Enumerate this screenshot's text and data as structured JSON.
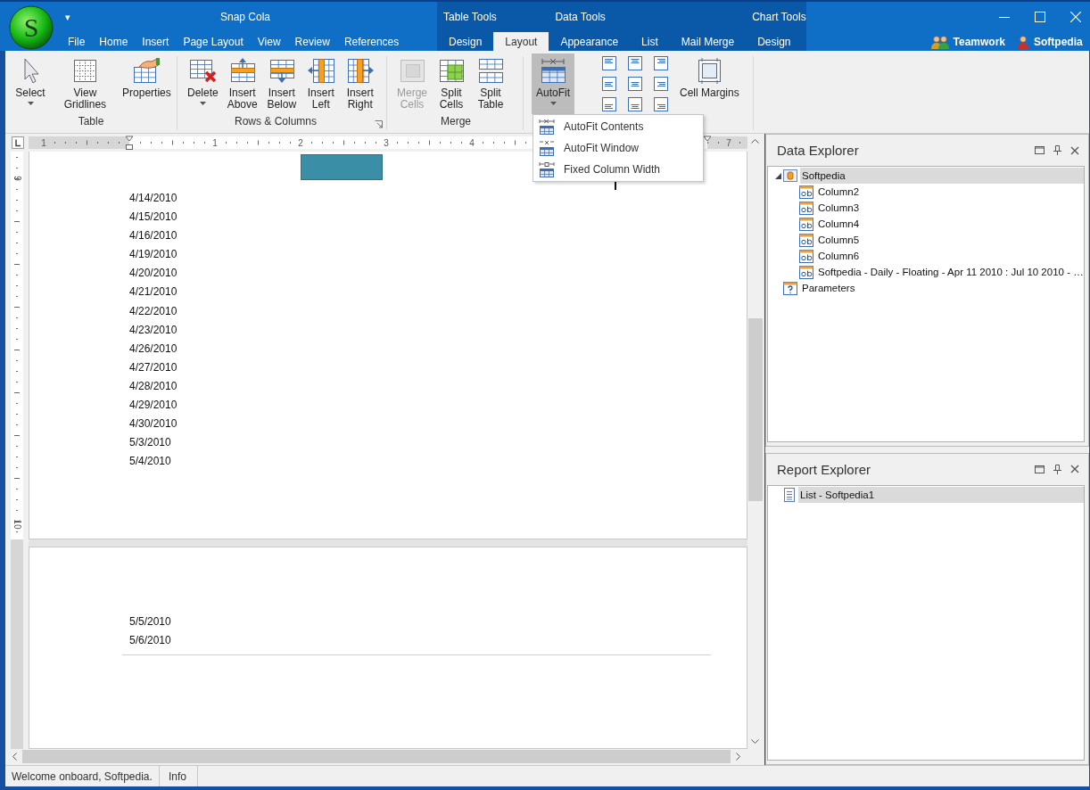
{
  "window": {
    "title": "Snap Cola",
    "logo_letter": "S",
    "quick_access": "▾"
  },
  "tabs": [
    {
      "label": "File",
      "selected": false
    },
    {
      "label": "Home",
      "selected": false
    },
    {
      "label": "Insert",
      "selected": false
    },
    {
      "label": "Page Layout",
      "selected": false
    },
    {
      "label": "View",
      "selected": false
    },
    {
      "label": "Review",
      "selected": false
    },
    {
      "label": "References",
      "selected": false
    }
  ],
  "context_groups": [
    {
      "label": "Table Tools",
      "tabs": [
        {
          "label": "Design",
          "selected": false
        },
        {
          "label": "Layout",
          "selected": true
        }
      ]
    },
    {
      "label": "Data Tools",
      "tabs": [
        {
          "label": "Appearance",
          "selected": false
        },
        {
          "label": "List",
          "selected": false
        },
        {
          "label": "Mail Merge",
          "selected": false
        }
      ]
    },
    {
      "label": "Chart Tools",
      "tabs": [
        {
          "label": "Design",
          "selected": false
        }
      ]
    }
  ],
  "users": [
    {
      "label": "Teamwork",
      "kind": "group"
    },
    {
      "label": "Softpedia",
      "kind": "person"
    }
  ],
  "ribbon": {
    "groups": [
      {
        "label": "Table",
        "launcher": false,
        "buttons": [
          {
            "label": "Select",
            "kind": "pointer",
            "menu": true,
            "disabled": false,
            "pressed": false
          },
          {
            "label": "View Gridlines",
            "kind": "gridlines",
            "menu": false,
            "disabled": false,
            "pressed": false
          },
          {
            "label": "Properties",
            "kind": "properties",
            "menu": false,
            "disabled": false,
            "pressed": false
          }
        ]
      },
      {
        "label": "Rows & Columns",
        "launcher": true,
        "buttons": [
          {
            "label": "Delete",
            "kind": "delete",
            "menu": true,
            "disabled": false,
            "pressed": false
          },
          {
            "label": "Insert\nAbove",
            "kind": "insert_above",
            "menu": false,
            "disabled": false,
            "pressed": false
          },
          {
            "label": "Insert\nBelow",
            "kind": "insert_below",
            "menu": false,
            "disabled": false,
            "pressed": false
          },
          {
            "label": "Insert\nLeft",
            "kind": "insert_left",
            "menu": false,
            "disabled": false,
            "pressed": false
          },
          {
            "label": "Insert\nRight",
            "kind": "insert_right",
            "menu": false,
            "disabled": false,
            "pressed": false
          }
        ]
      },
      {
        "label": "Merge",
        "launcher": false,
        "buttons": [
          {
            "label": "Merge\nCells",
            "kind": "merge",
            "menu": false,
            "disabled": true,
            "pressed": false
          },
          {
            "label": "Split\nCells",
            "kind": "split_cells",
            "menu": false,
            "disabled": false,
            "pressed": false
          },
          {
            "label": "Split\nTable",
            "kind": "split_table",
            "menu": false,
            "disabled": false,
            "pressed": false
          }
        ]
      },
      {
        "launcher": false,
        "buttons": [
          {
            "label": "AutoFit",
            "kind": "autofit",
            "menu": true,
            "disabled": false,
            "pressed": true
          }
        ]
      },
      {
        "kind": "alignment",
        "launcher": false,
        "buttons": [
          {
            "label": "Cell Margins",
            "kind": "margins",
            "menu": false,
            "disabled": false,
            "pressed": false
          }
        ]
      }
    ]
  },
  "autofit_menu": {
    "items": [
      {
        "label": "AutoFit Contents",
        "kind": "contents"
      },
      {
        "label": "AutoFit Window",
        "kind": "window"
      },
      {
        "label": "Fixed Column Width",
        "kind": "fixed"
      }
    ]
  },
  "ruler": {
    "labels": [
      "1",
      "1",
      "2",
      "3",
      "4",
      "7"
    ]
  },
  "vertical_ruler": {
    "labels": [
      "9",
      "10"
    ]
  },
  "pages": [
    {
      "header_block": true,
      "dates": [
        "4/14/2010",
        "4/15/2010",
        "4/16/2010",
        "4/19/2010",
        "4/20/2010",
        "4/21/2010",
        "4/22/2010",
        "4/23/2010",
        "4/26/2010",
        "4/27/2010",
        "4/28/2010",
        "4/29/2010",
        "4/30/2010",
        "5/3/2010",
        "5/4/2010"
      ]
    },
    {
      "header_block": false,
      "dates": [
        "5/5/2010",
        "5/6/2010"
      ]
    }
  ],
  "data_explorer": {
    "title": "Data Explorer",
    "tree": [
      {
        "label": "Softpedia",
        "kind": "datasource",
        "selected": true,
        "expanded": true,
        "children": [
          {
            "label": "Column2",
            "kind": "field",
            "selected": false
          },
          {
            "label": "Column3",
            "kind": "field",
            "selected": false
          },
          {
            "label": "Column4",
            "kind": "field",
            "selected": false
          },
          {
            "label": "Column5",
            "kind": "field",
            "selected": false
          },
          {
            "label": "Column6",
            "kind": "field",
            "selected": false
          },
          {
            "label": "Softpedia - Daily - Floating - Apr 11 2010 : Jul 10 2010 - …",
            "kind": "field",
            "selected": false
          }
        ]
      },
      {
        "label": "Parameters",
        "kind": "parameters",
        "selected": false
      }
    ]
  },
  "report_explorer": {
    "title": "Report Explorer",
    "tree": [
      {
        "label": "List - Softpedia1",
        "kind": "report",
        "selected": true
      }
    ]
  },
  "status_bar": [
    "Welcome onboard, Softpedia.",
    "Info"
  ]
}
